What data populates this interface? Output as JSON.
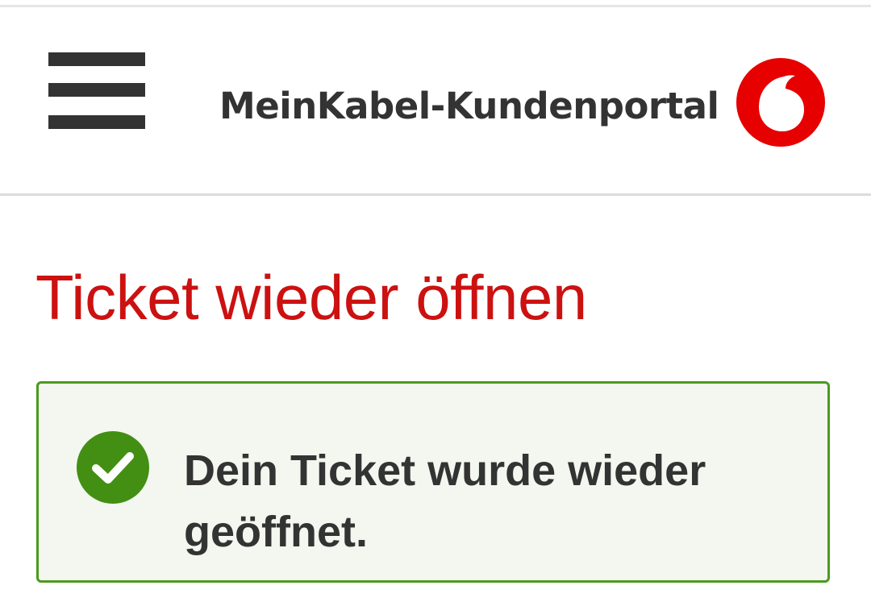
{
  "header": {
    "title": "MeinKabel-Kundenportal",
    "menu_icon": "hamburger-menu-icon",
    "logo_icon": "vodafone-logo",
    "brand_color": "#e60000"
  },
  "main": {
    "page_title": "Ticket wieder öffnen",
    "alert": {
      "type": "success",
      "icon": "checkmark-circle-icon",
      "message": "Dein Ticket wurde wieder geöffnet.",
      "accent_color": "#4a9a1e"
    }
  }
}
